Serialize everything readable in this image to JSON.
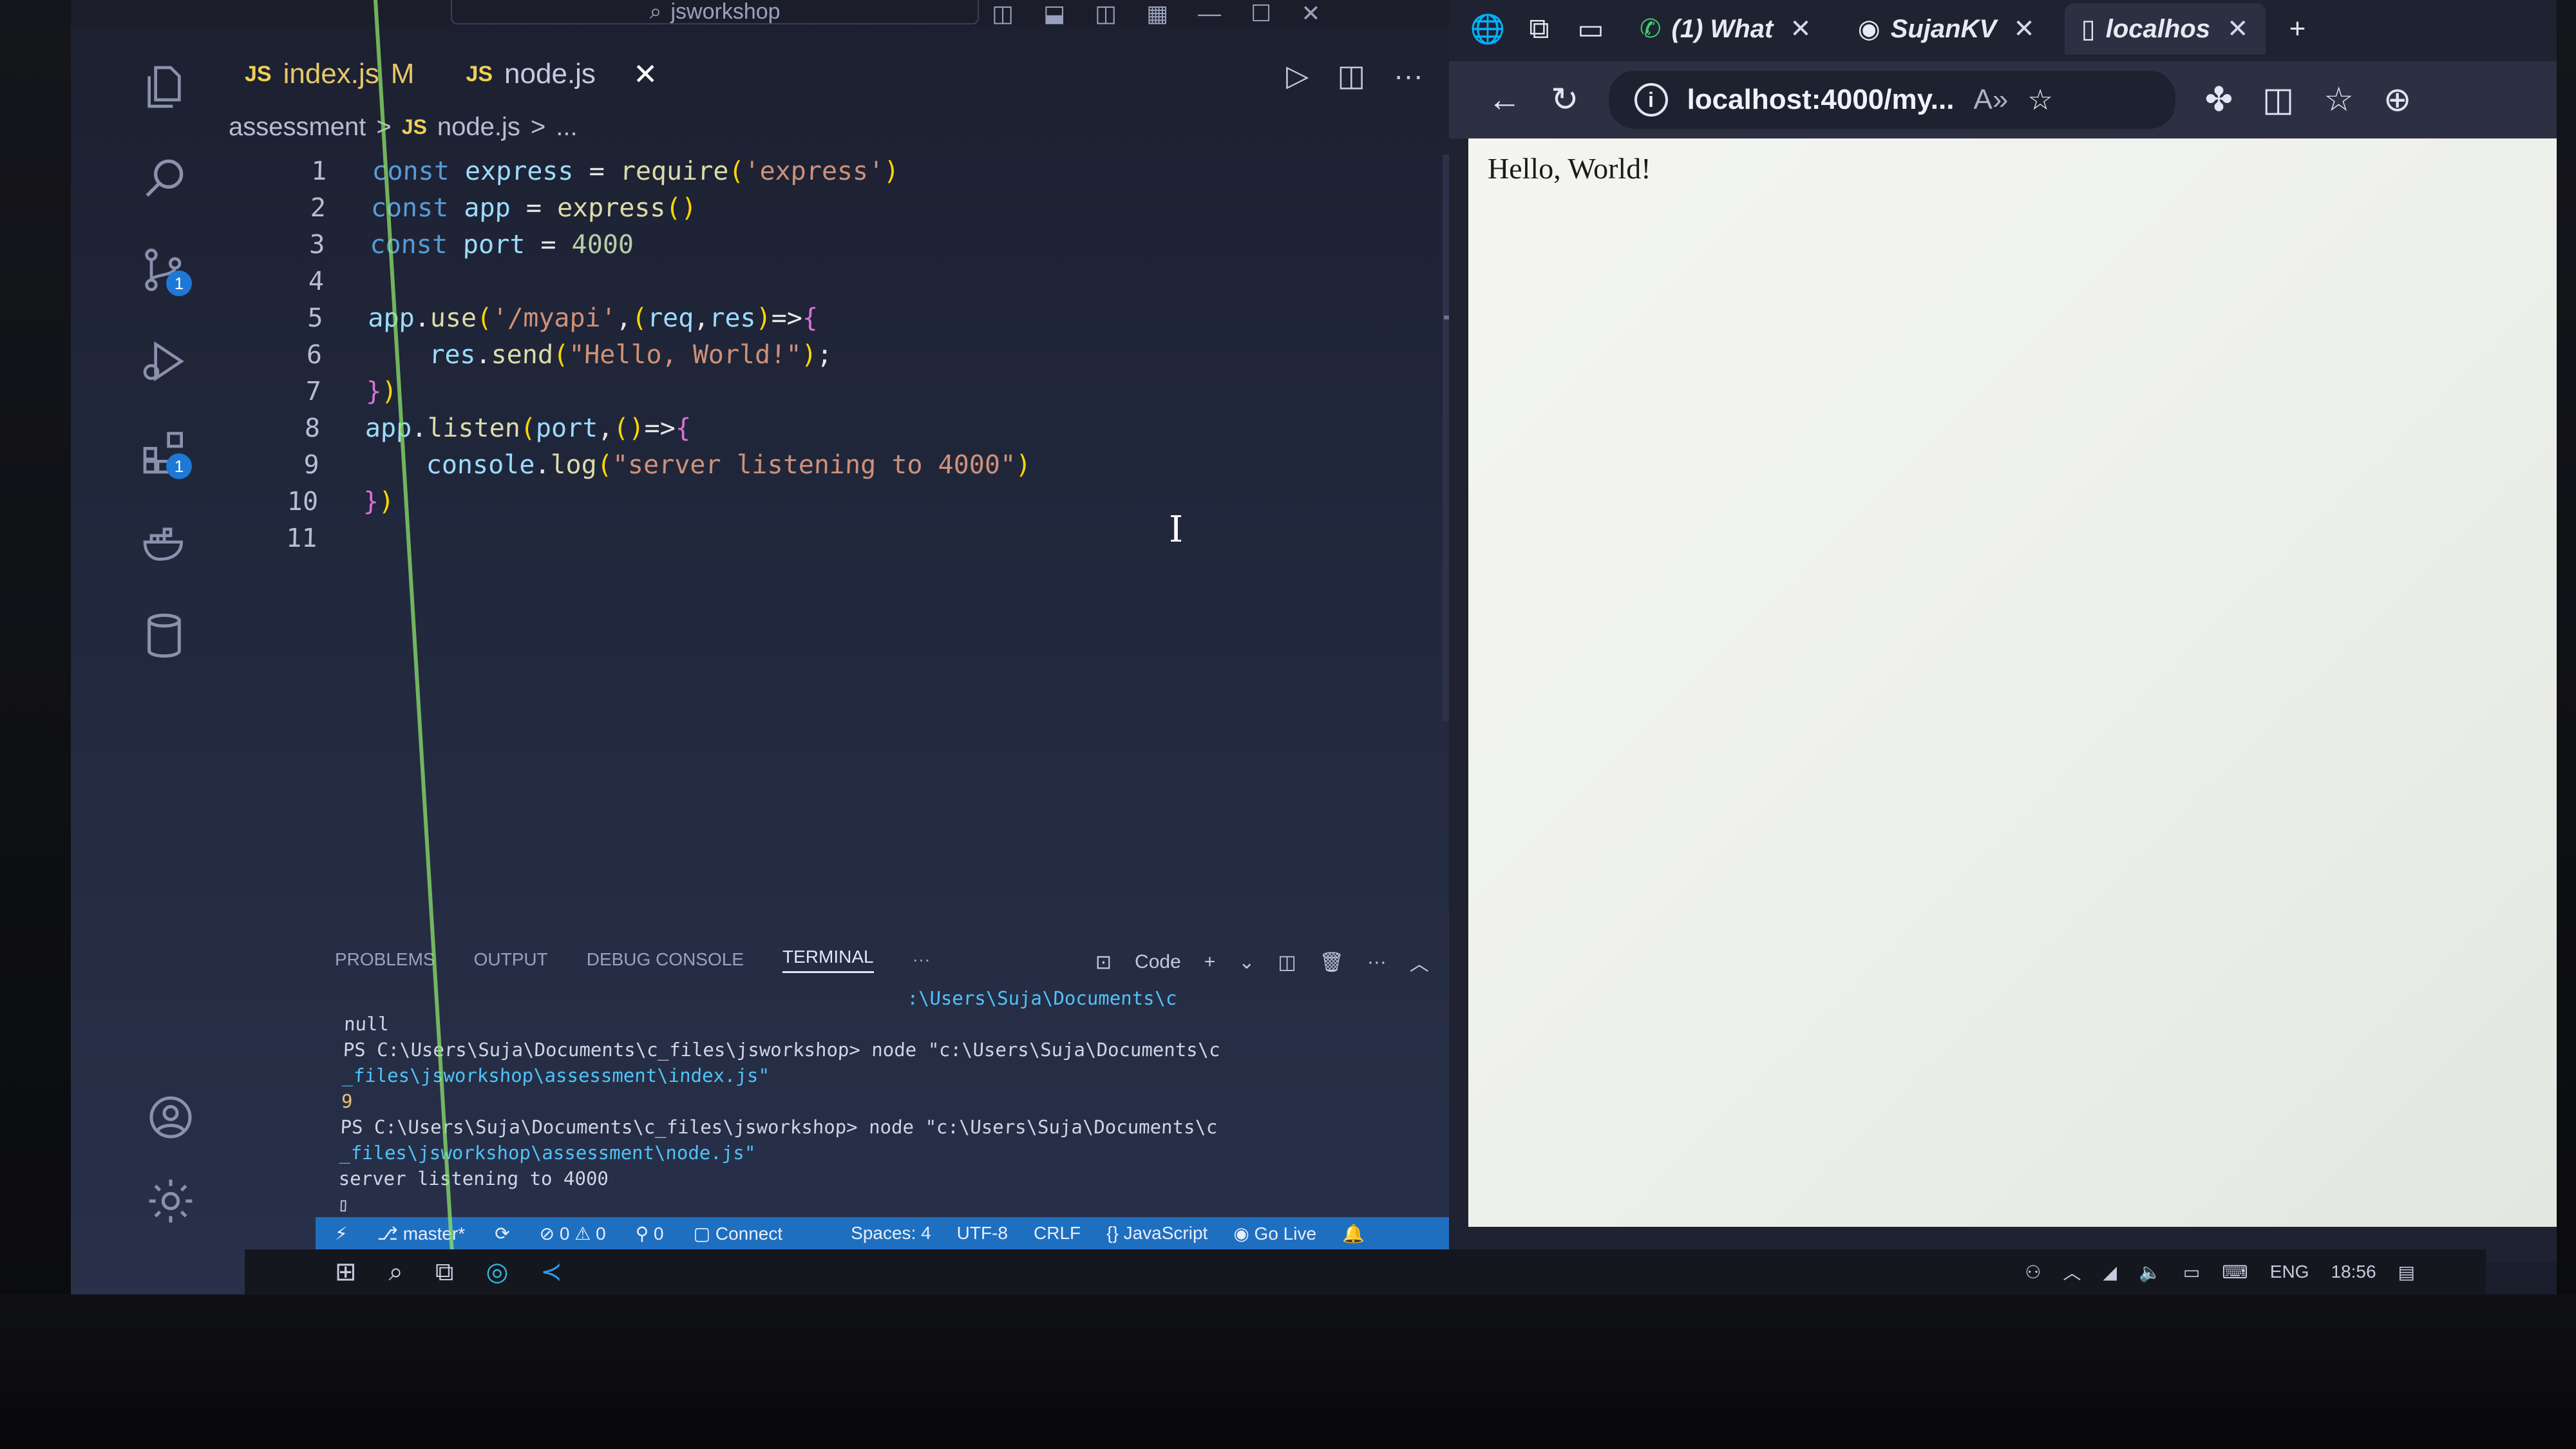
{
  "vscode": {
    "window_title": "jsworkshop",
    "tabs": [
      {
        "label": "index.js",
        "modified": "M"
      },
      {
        "label": "node.js",
        "close": "✕"
      }
    ],
    "breadcrumb": [
      "assessment",
      ">",
      "JS",
      "node.js",
      ">",
      "..."
    ],
    "code_lines": [
      "const express = require('express')",
      "const app = express()",
      "const port = 4000",
      "",
      "app.use('/myapi',(req,res)=>{",
      "    res.send(\"Hello, World!\");",
      "})",
      "app.listen(port,()=>{",
      "    console.log(\"server listening to 4000\")",
      "})",
      ""
    ],
    "line_numbers": [
      "1",
      "2",
      "3",
      "4",
      "5",
      "6",
      "7",
      "8",
      "9",
      "10",
      "11"
    ],
    "activity_badges": {
      "source_control": "1",
      "extensions": "1"
    },
    "panel": {
      "tabs": [
        "PROBLEMS",
        "OUTPUT",
        "DEBUG CONSOLE",
        "TERMINAL",
        "···"
      ],
      "active_tab": "TERMINAL",
      "shell_label": "Code",
      "terminal_lines": [
        "                                                  :\\Users\\Suja\\Documents\\c",
        "null",
        "PS C:\\Users\\Suja\\Documents\\c_files\\jsworkshop> node \"c:\\Users\\Suja\\Documents\\c",
        "_files\\jsworkshop\\assessment\\index.js\"",
        "9",
        "PS C:\\Users\\Suja\\Documents\\c_files\\jsworkshop> node \"c:\\Users\\Suja\\Documents\\c",
        "_files\\jsworkshop\\assessment\\node.js\"",
        "server listening to 4000",
        "▯"
      ]
    },
    "statusbar": {
      "branch": "master*",
      "errors": "0",
      "warnings": "0",
      "ports": "0",
      "connect": "Connect",
      "spaces": "Spaces: 4",
      "encoding": "UTF-8",
      "eol": "CRLF",
      "language": "JavaScript",
      "golive": "Go Live"
    }
  },
  "browser": {
    "tabs": [
      {
        "label": "(1) What",
        "icon": "whatsapp-icon"
      },
      {
        "label": "SujanKV",
        "icon": "github-icon"
      },
      {
        "label": "localhos",
        "icon": "page-icon"
      }
    ],
    "address": "localhost:4000/my...",
    "page_text": "Hello, World!"
  },
  "taskbar": {
    "language": "ENG",
    "time": "18:56"
  },
  "colors": {
    "statusbar": "#1f6fc0",
    "keyword": "#569cd6",
    "string": "#ce9178",
    "function": "#dcdcaa"
  }
}
